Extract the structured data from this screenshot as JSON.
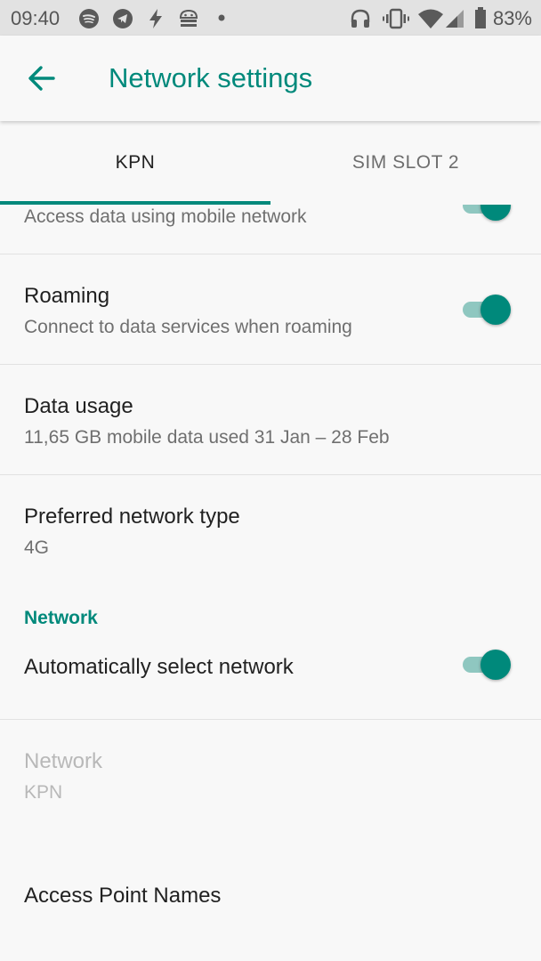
{
  "status_bar": {
    "time": "09:40",
    "battery_percent": "83%",
    "icons_left": [
      "spotify-icon",
      "telegram-icon",
      "flash-icon",
      "android-debug-icon",
      "dot-icon"
    ],
    "icons_right": [
      "headphones-icon",
      "vibrate-icon",
      "wifi-icon",
      "signal-icon",
      "battery-icon"
    ]
  },
  "app_bar": {
    "title": "Network settings",
    "back_icon": "arrow-back-icon"
  },
  "tabs": [
    {
      "label": "KPN",
      "selected": true
    },
    {
      "label": "SIM SLOT 2",
      "selected": false
    }
  ],
  "rows": {
    "mobile_data": {
      "subtitle": "Access data using mobile network",
      "toggle_on": true
    },
    "roaming": {
      "title": "Roaming",
      "subtitle": "Connect to data services when roaming",
      "toggle_on": true
    },
    "data_usage": {
      "title": "Data usage",
      "subtitle": "11,65 GB mobile data used 31 Jan – 28 Feb"
    },
    "preferred_network": {
      "title": "Preferred network type",
      "subtitle": "4G"
    }
  },
  "network_section": {
    "header": "Network",
    "auto_select": {
      "title": "Automatically select network",
      "toggle_on": true
    },
    "network": {
      "title": "Network",
      "subtitle": "KPN",
      "disabled": true
    },
    "apn": {
      "title": "Access Point Names"
    }
  },
  "colors": {
    "accent": "#00897b",
    "status_bar_bg": "#e2e2e2",
    "background": "#f8f8f8"
  }
}
